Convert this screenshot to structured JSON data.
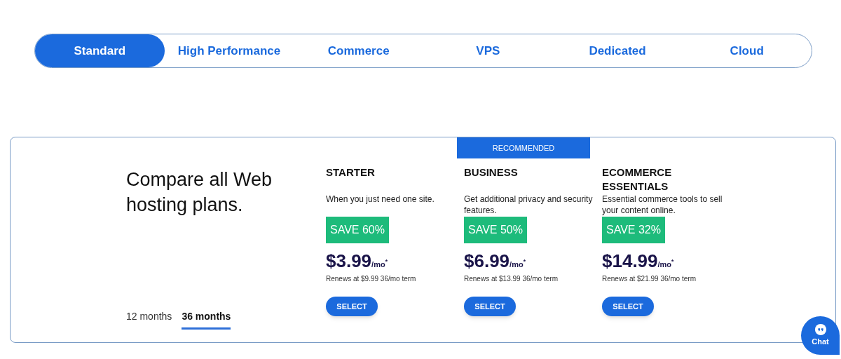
{
  "tabs": [
    {
      "label": "Standard",
      "selected": true
    },
    {
      "label": "High Performance",
      "selected": false
    },
    {
      "label": "Commerce",
      "selected": false
    },
    {
      "label": "VPS",
      "selected": false
    },
    {
      "label": "Dedicated",
      "selected": false
    },
    {
      "label": "Cloud",
      "selected": false
    }
  ],
  "compare": {
    "heading": "Compare all Web hosting plans.",
    "periods": [
      {
        "label": "12 months",
        "selected": false
      },
      {
        "label": "36 months",
        "selected": true
      }
    ]
  },
  "plans": [
    {
      "name": "STARTER",
      "description": "When you just need one site.",
      "save": "SAVE 60%",
      "price": "$3.99",
      "unit": "/mo",
      "note": "*",
      "renews": "Renews at $9.99 36/mo term",
      "button": "SELECT"
    },
    {
      "badge": "RECOMMENDED",
      "name": "BUSINESS",
      "description": "Get additional privacy and security features.",
      "save": "SAVE 50%",
      "price": "$6.99",
      "unit": "/mo",
      "note": "*",
      "renews": "Renews at $13.99 36/mo term",
      "button": "SELECT"
    },
    {
      "name": "ECOMMERCE ESSENTIALS",
      "description": "Essential commerce tools to sell your content online.",
      "save": "SAVE 32%",
      "price": "$14.99",
      "unit": "/mo",
      "note": "*",
      "renews": "Renews at $21.99 36/mo term",
      "button": "SELECT"
    }
  ],
  "chat": {
    "label": "Chat"
  }
}
